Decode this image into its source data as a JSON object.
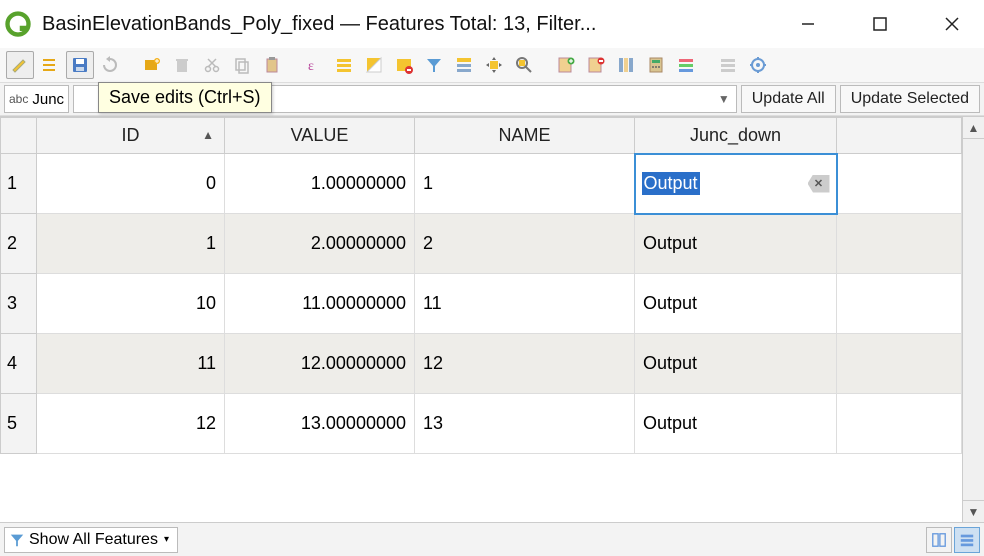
{
  "window": {
    "title": "BasinElevationBands_Poly_fixed — Features Total: 13, Filter..."
  },
  "tooltip": "Save edits (Ctrl+S)",
  "field_selector": {
    "prefix": "abc",
    "value": "Junc"
  },
  "buttons": {
    "update_all": "Update All",
    "update_selected": "Update Selected"
  },
  "columns": [
    "ID",
    "VALUE",
    "NAME",
    "Junc_down"
  ],
  "sorted_column": "ID",
  "rows": [
    {
      "n": "1",
      "id": "0",
      "value": "1.00000000",
      "name": "1",
      "junc": "Output",
      "editing": true
    },
    {
      "n": "2",
      "id": "1",
      "value": "2.00000000",
      "name": "2",
      "junc": "Output"
    },
    {
      "n": "3",
      "id": "10",
      "value": "11.00000000",
      "name": "11",
      "junc": "Output"
    },
    {
      "n": "4",
      "id": "11",
      "value": "12.00000000",
      "name": "12",
      "junc": "Output"
    },
    {
      "n": "5",
      "id": "12",
      "value": "13.00000000",
      "name": "13",
      "junc": "Output"
    }
  ],
  "statusbar": {
    "show_all": "Show All Features"
  },
  "chart_data": {
    "type": "table",
    "title": "BasinElevationBands_Poly_fixed attribute table",
    "columns": [
      "ID",
      "VALUE",
      "NAME",
      "Junc_down"
    ],
    "rows": [
      [
        0,
        1.0,
        "1",
        "Output"
      ],
      [
        1,
        2.0,
        "2",
        "Output"
      ],
      [
        10,
        11.0,
        "11",
        "Output"
      ],
      [
        11,
        12.0,
        "12",
        "Output"
      ],
      [
        12,
        13.0,
        "13",
        "Output"
      ]
    ],
    "features_total": 13
  }
}
